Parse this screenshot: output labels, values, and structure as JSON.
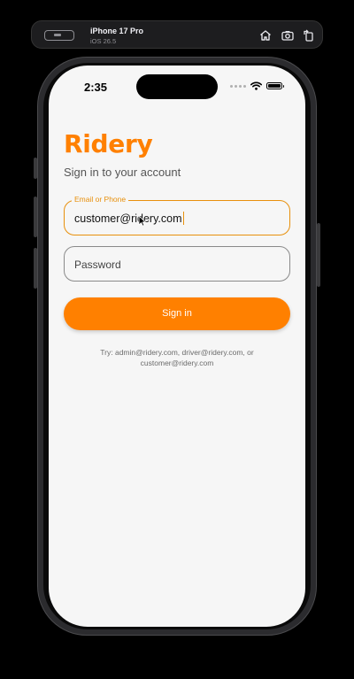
{
  "simulator": {
    "device_name": "iPhone 17 Pro",
    "os_version": "iOS 26.5"
  },
  "status_bar": {
    "time": "2:35"
  },
  "app": {
    "brand": "Ridery",
    "subtitle": "Sign in to your account",
    "email_field": {
      "label": "Email or Phone",
      "value": "customer@ridery.com"
    },
    "password_field": {
      "placeholder": "Password",
      "value": ""
    },
    "signin_label": "Sign in",
    "hint_line1": "Try: admin@ridery.com, driver@ridery.com, or",
    "hint_line2": "customer@ridery.com"
  },
  "colors": {
    "brand": "#ff8000",
    "focus_border": "#e8900c",
    "screen_background": "#f6f6f6"
  }
}
